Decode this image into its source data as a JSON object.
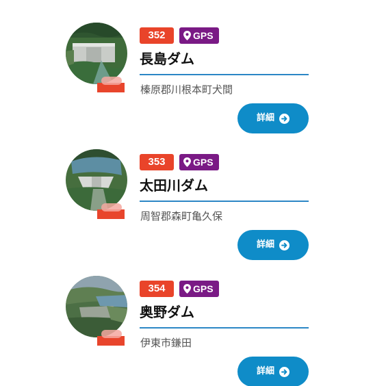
{
  "colors": {
    "number_badge": "#e9442a",
    "gps_badge": "#7a1a85",
    "rule": "#2b86c5",
    "detail_button": "#0f8cc8"
  },
  "dams": [
    {
      "number": "352",
      "gps_label": "GPS",
      "gps_icon": "map-pin-icon",
      "name": "長島ダム",
      "address": "榛原郡川根本町犬間",
      "detail_label": "詳細",
      "detail_icon": "arrow-right-circle-icon",
      "photo": "dam-photo"
    },
    {
      "number": "353",
      "gps_label": "GPS",
      "gps_icon": "map-pin-icon",
      "name": "太田川ダム",
      "address": "周智郡森町亀久保",
      "detail_label": "詳細",
      "detail_icon": "arrow-right-circle-icon",
      "photo": "dam-photo"
    },
    {
      "number": "354",
      "gps_label": "GPS",
      "gps_icon": "map-pin-icon",
      "name": "奥野ダム",
      "address": "伊東市鎌田",
      "detail_label": "詳細",
      "detail_icon": "arrow-right-circle-icon",
      "photo": "dam-photo"
    }
  ]
}
